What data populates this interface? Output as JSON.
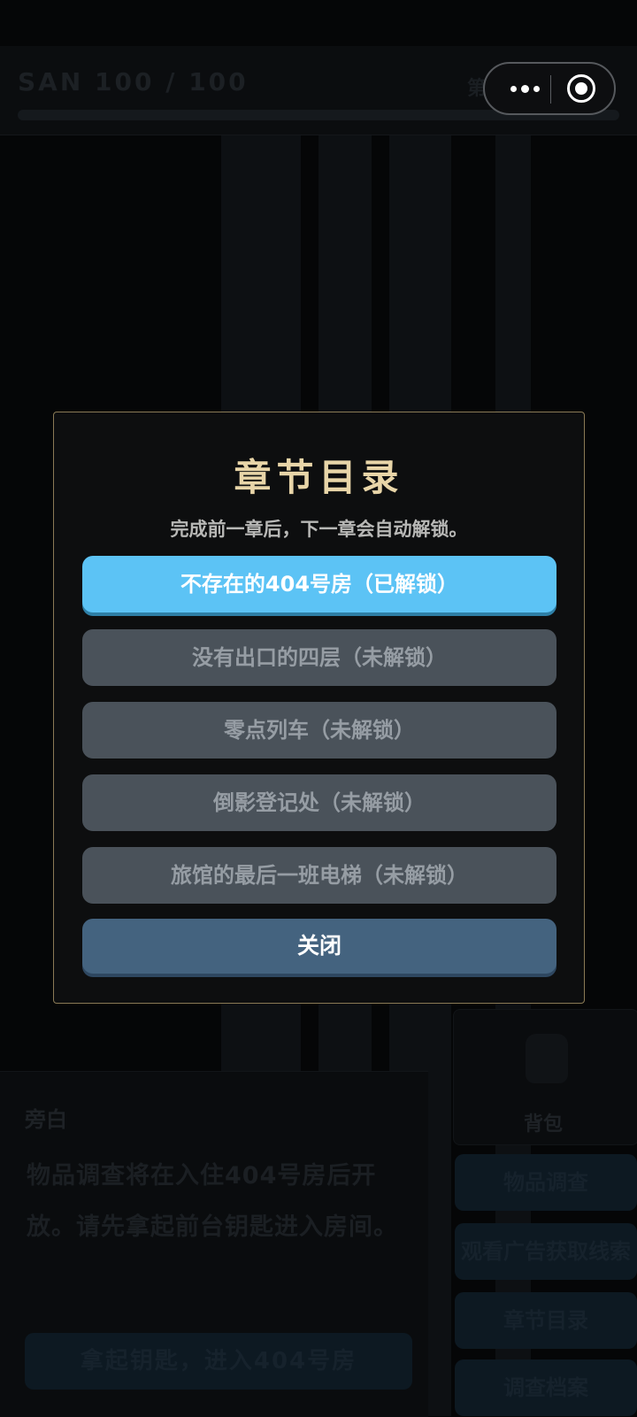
{
  "status": {
    "san_text": "SAN 100 / 100",
    "chapter_hint": "第",
    "san_level": 1.0
  },
  "capsule": {
    "more_icon": "more-dots-icon",
    "close_icon": "target-circle-icon"
  },
  "side_panel": {
    "bag_icon": "backpack-icon",
    "bag_label": "背包",
    "buttons": [
      "物品调查",
      "观看广告获取线索",
      "章节目录",
      "调查档案"
    ]
  },
  "narration": {
    "speaker": "旁白",
    "text": "物品调查将在入住404号房后开放。请先拿起前台钥匙进入房间。",
    "action_label": "拿起钥匙，进入404号房"
  },
  "modal": {
    "title": "章节目录",
    "subtitle": "完成前一章后，下一章会自动解锁。",
    "chapters": [
      {
        "label": "不存在的404号房（已解锁）",
        "unlocked": true
      },
      {
        "label": "没有出口的四层（未解锁）",
        "unlocked": false
      },
      {
        "label": "零点列车（未解锁）",
        "unlocked": false
      },
      {
        "label": "倒影登记处（未解锁）",
        "unlocked": false
      },
      {
        "label": "旅馆的最后一班电梯（未解锁）",
        "unlocked": false
      }
    ],
    "close_label": "关闭"
  },
  "colors": {
    "accent_gold": "#e8d5a8",
    "unlocked_blue": "#5cc3f5",
    "locked_gray": "#4a525a",
    "close_blue": "#44637f"
  }
}
